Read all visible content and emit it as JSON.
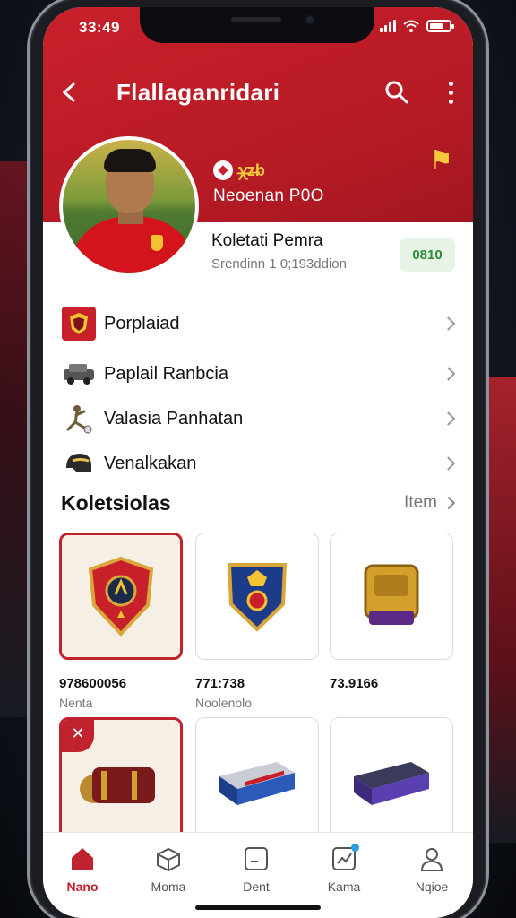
{
  "status": {
    "time": "33:49"
  },
  "appbar": {
    "title": "Flallaganridari"
  },
  "profile": {
    "badge_text": "ꭓ̶z̶b",
    "hero_name": "Neoenan P0O",
    "name": "Koletati Pemra",
    "subtitle": "Srendinn 1 0;193ddion",
    "pill": "0810"
  },
  "menu": [
    {
      "label": "Porplaiad",
      "icon": "crest-icon"
    },
    {
      "label": "Paplail Ranbcia",
      "icon": "car-icon"
    },
    {
      "label": "Valasia Panhatan",
      "icon": "player-icon"
    },
    {
      "label": "Venalkakan",
      "icon": "helmet-icon"
    }
  ],
  "collection": {
    "title": "Koletsiolas",
    "link": "Item",
    "tiles": [
      {
        "price": "978600056",
        "sub": "Nenta",
        "icon": "shield-red-icon"
      },
      {
        "price": "771:738",
        "sub": "Noolenolo",
        "icon": "shield-blue-icon"
      },
      {
        "price": "73.9166",
        "sub": "",
        "icon": "gold-badge-icon"
      },
      {
        "price": "",
        "sub": "",
        "icon": "cannon-icon"
      },
      {
        "price": "",
        "sub": "",
        "icon": "train-blue-icon"
      },
      {
        "price": "",
        "sub": "",
        "icon": "train-purple-icon"
      }
    ]
  },
  "tabs": [
    {
      "label": "Nano",
      "icon": "home-icon",
      "active": true
    },
    {
      "label": "Moma",
      "icon": "box-icon"
    },
    {
      "label": "Dent",
      "icon": "card-icon"
    },
    {
      "label": "Kama",
      "icon": "chart-icon"
    },
    {
      "label": "Nqioe",
      "icon": "user-icon"
    }
  ],
  "colors": {
    "primary": "#c0232d",
    "accent": "#f4c93a",
    "success": "#2b8a34"
  }
}
